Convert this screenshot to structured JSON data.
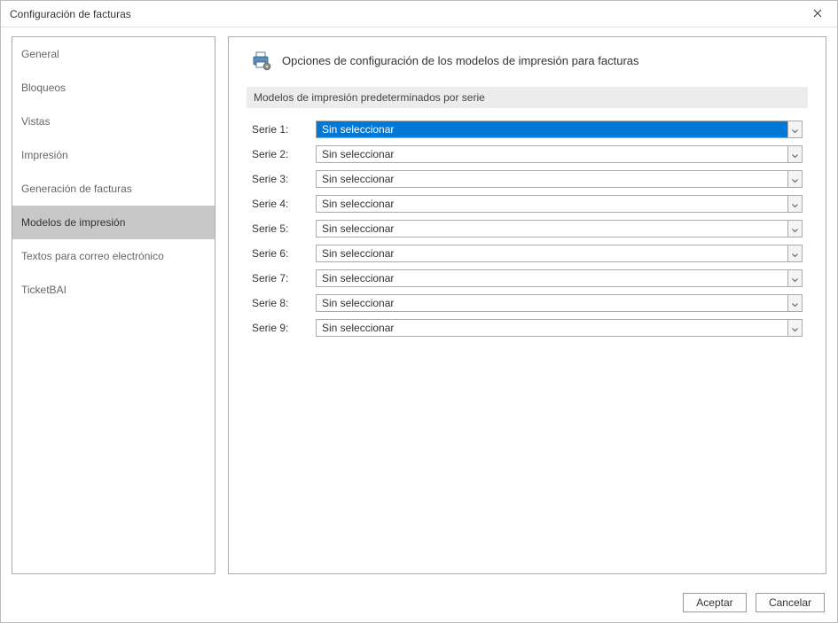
{
  "window": {
    "title": "Configuración de facturas"
  },
  "sidebar": {
    "items": [
      {
        "label": "General",
        "selected": false
      },
      {
        "label": "Bloqueos",
        "selected": false
      },
      {
        "label": "Vistas",
        "selected": false
      },
      {
        "label": "Impresión",
        "selected": false
      },
      {
        "label": "Generación de facturas",
        "selected": false
      },
      {
        "label": "Modelos de impresión",
        "selected": true
      },
      {
        "label": "Textos para correo electrónico",
        "selected": false
      },
      {
        "label": "TicketBAI",
        "selected": false
      }
    ]
  },
  "main": {
    "header_title": "Opciones de configuración de los modelos de impresión para facturas",
    "section_title": "Modelos de impresión predeterminados por serie",
    "rows": [
      {
        "label": "Serie 1:",
        "value": "Sin seleccionar",
        "focused": true
      },
      {
        "label": "Serie 2:",
        "value": "Sin seleccionar",
        "focused": false
      },
      {
        "label": "Serie 3:",
        "value": "Sin seleccionar",
        "focused": false
      },
      {
        "label": "Serie 4:",
        "value": "Sin seleccionar",
        "focused": false
      },
      {
        "label": "Serie 5:",
        "value": "Sin seleccionar",
        "focused": false
      },
      {
        "label": "Serie 6:",
        "value": "Sin seleccionar",
        "focused": false
      },
      {
        "label": "Serie 7:",
        "value": "Sin seleccionar",
        "focused": false
      },
      {
        "label": "Serie 8:",
        "value": "Sin seleccionar",
        "focused": false
      },
      {
        "label": "Serie 9:",
        "value": "Sin seleccionar",
        "focused": false
      }
    ]
  },
  "footer": {
    "accept": "Aceptar",
    "cancel": "Cancelar"
  }
}
